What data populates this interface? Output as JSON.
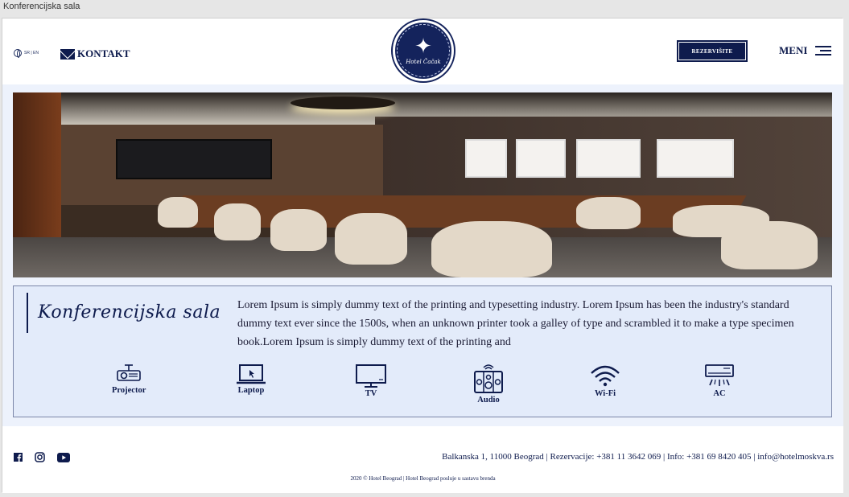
{
  "window": {
    "title": "Konferencijska sala"
  },
  "header": {
    "lang": "SR | EN",
    "contact_label": "KONTAKT",
    "logo_text": "Hotel Čačak",
    "reserve_label": "REZERVIŠITE",
    "menu_label": "MENI"
  },
  "hall": {
    "title": "Konferencijska sala",
    "description": "Lorem Ipsum is simply dummy text of the printing and typesetting industry. Lorem Ipsum has been the industry's standard dummy text ever since the 1500s, when an unknown printer took a galley of type and scrambled it to make a type specimen book.Lorem Ipsum is simply dummy text of the printing and"
  },
  "amenities": [
    {
      "label": "Projector",
      "icon": "projector-icon"
    },
    {
      "label": "Laptop",
      "icon": "laptop-icon"
    },
    {
      "label": "TV",
      "icon": "tv-icon"
    },
    {
      "label": "Audio",
      "icon": "speaker-icon"
    },
    {
      "label": "Wi-Fi",
      "icon": "wifi-icon"
    },
    {
      "label": "AC",
      "icon": "air-conditioner-icon"
    }
  ],
  "footer": {
    "social": [
      "facebook-icon",
      "instagram-icon",
      "youtube-icon"
    ],
    "contact": "Balkanska 1, 11000 Beograd | Rezervacije: +381 11 3642 069 | Info: +381 69 8420 405 | info@hotelmoskva.rs",
    "copyright": "2020 © Hotel Beograd | Hotel Beograd posluje u sastavu brenda"
  },
  "colors": {
    "primary": "#0e1b4d",
    "panel_bg": "#e3ebfa",
    "content_bg": "#edf2fc"
  }
}
